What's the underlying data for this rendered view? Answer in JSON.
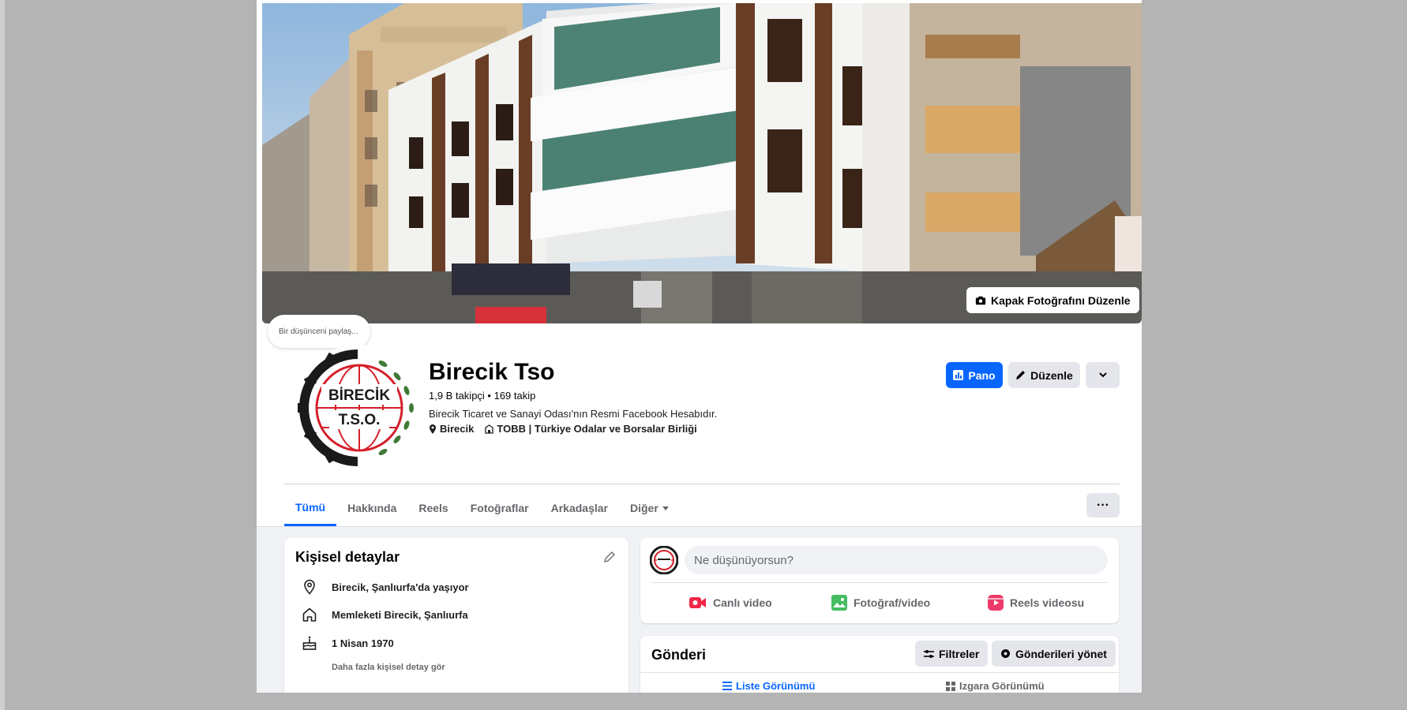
{
  "cover": {
    "edit_label": "Kapak Fotoğrafını Düzenle",
    "thought_placeholder": "Bir düşünceni paylaş..."
  },
  "profile": {
    "logo_text_top": "BİRECİK",
    "logo_text_bottom": "T.S.O.",
    "name": "Birecik Tso",
    "followers": "1,9 B takipçi • 169 takip",
    "bio": "Birecik Ticaret ve Sanayi Odası'nın Resmi Facebook Hesabıdır.",
    "location": "Birecik",
    "organization": "TOBB | Türkiye Odalar ve Borsalar Birliği"
  },
  "actions": {
    "dashboard_label": "Pano",
    "edit_label": "Düzenle"
  },
  "tabs": {
    "items": [
      "Tümü",
      "Hakkında",
      "Reels",
      "Fotoğraflar",
      "Arkadaşlar",
      "Diğer"
    ],
    "active": "Tümü",
    "more_label": "···"
  },
  "intro": {
    "title": "Kişisel detaylar",
    "lives_in": "Birecik, Şanlıurfa'da yaşıyor",
    "hometown": "Memleketi Birecik, Şanlıurfa",
    "birthday": "1 Nisan 1970",
    "see_more": "Daha fazla kişisel detay gör"
  },
  "composer": {
    "placeholder": "Ne düşünüyorsun?",
    "live_video": "Canlı video",
    "photo_video": "Fotoğraf/video",
    "reels_video": "Reels videosu"
  },
  "posts": {
    "title": "Gönderi",
    "filters_label": "Filtreler",
    "manage_label": "Gönderileri yönet",
    "list_view": "Liste Görünümü",
    "grid_view": "Izgara Görünümü"
  },
  "colors": {
    "accent": "#0866ff",
    "page_bg": "#f0f2f5",
    "live_red": "#f02849",
    "photo_green": "#45bd62",
    "reels_pink": "#ec3b6a"
  }
}
